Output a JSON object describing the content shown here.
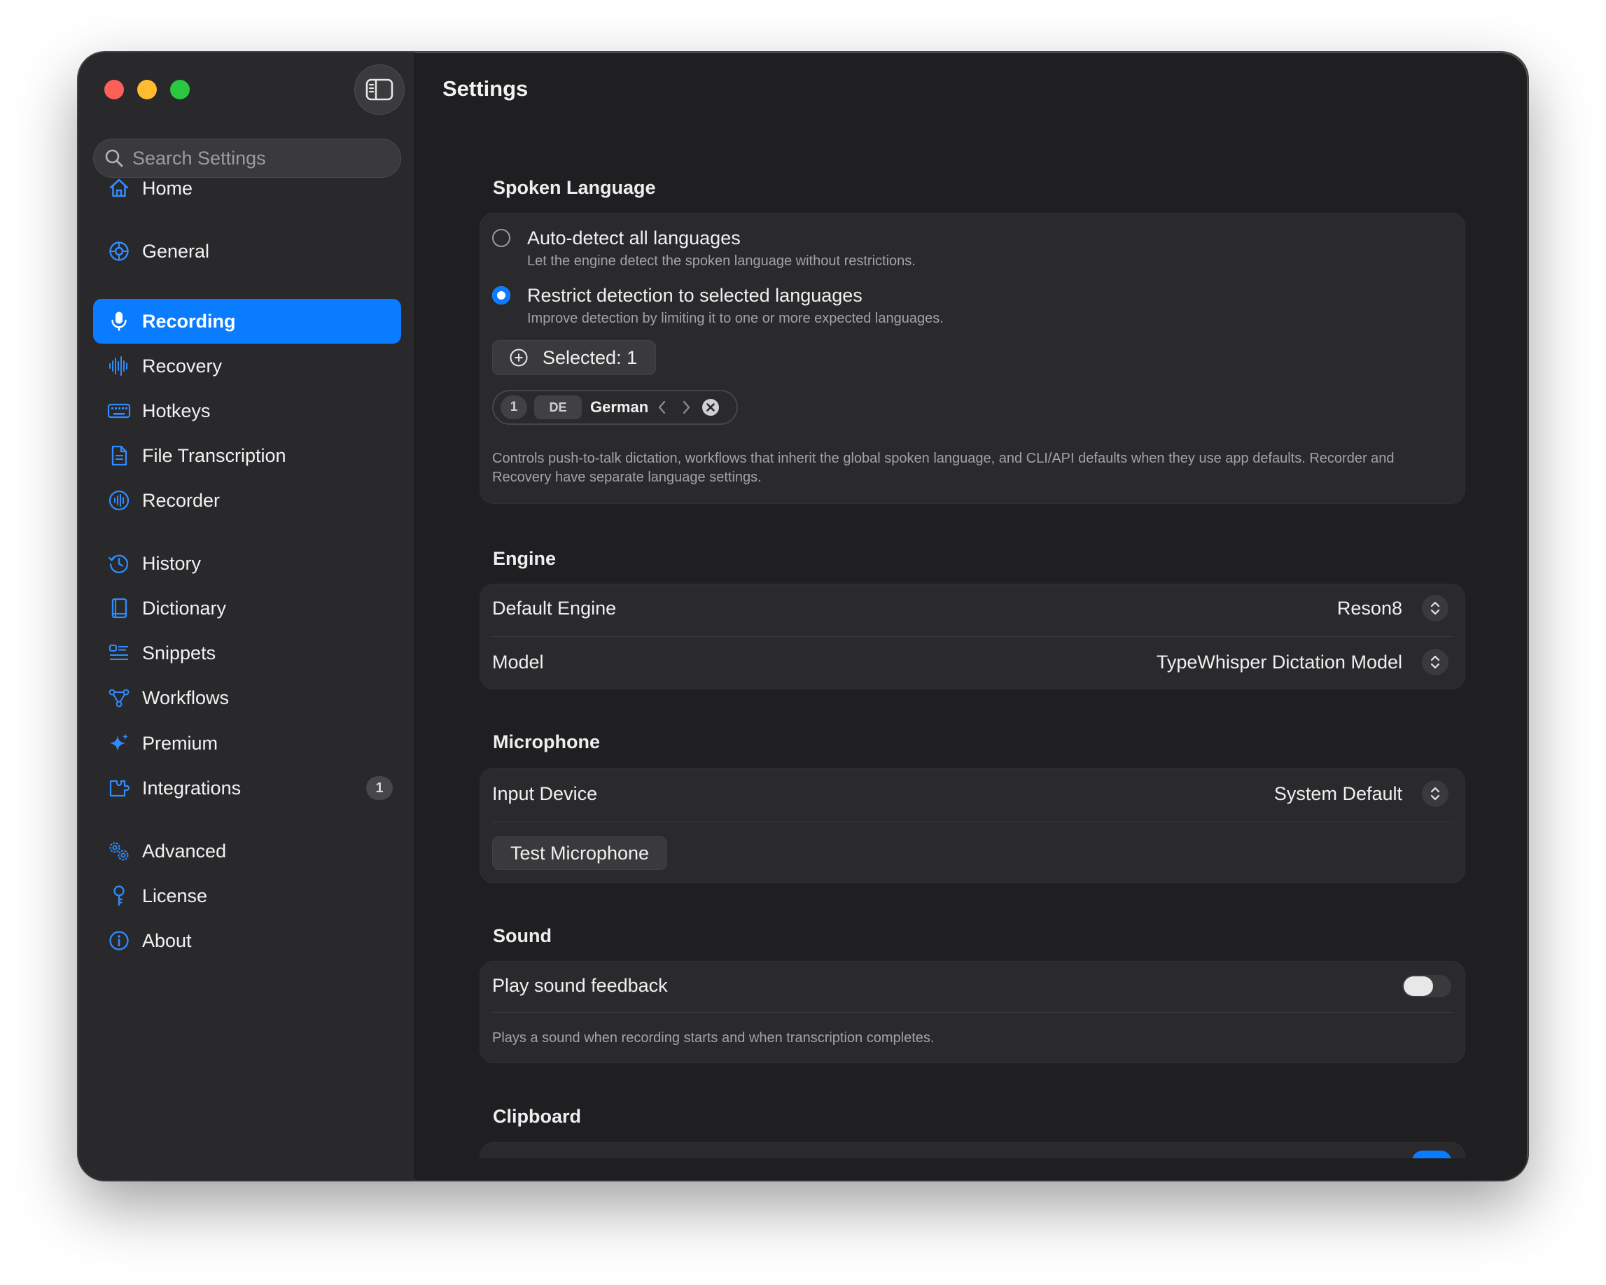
{
  "window": {
    "title": "Settings"
  },
  "sidebar": {
    "search_placeholder": "Search Settings",
    "items": [
      {
        "label": "Home",
        "icon": "house-icon"
      },
      {
        "label": "General",
        "icon": "gear-icon"
      },
      {
        "label": "Recording",
        "icon": "microphone-icon",
        "active": true
      },
      {
        "label": "Recovery",
        "icon": "waveform-icon"
      },
      {
        "label": "Hotkeys",
        "icon": "keyboard-icon"
      },
      {
        "label": "File Transcription",
        "icon": "document-icon"
      },
      {
        "label": "Recorder",
        "icon": "record-waveform-icon"
      },
      {
        "label": "History",
        "icon": "clock-history-icon"
      },
      {
        "label": "Dictionary",
        "icon": "book-icon"
      },
      {
        "label": "Snippets",
        "icon": "snippets-list-icon"
      },
      {
        "label": "Workflows",
        "icon": "workflow-nodes-icon"
      },
      {
        "label": "Premium",
        "icon": "sparkles-icon"
      },
      {
        "label": "Integrations",
        "icon": "puzzle-icon",
        "badge": "1"
      },
      {
        "label": "Advanced",
        "icon": "gears-icon"
      },
      {
        "label": "License",
        "icon": "key-icon"
      },
      {
        "label": "About",
        "icon": "info-circle-icon"
      }
    ]
  },
  "spoken_language": {
    "title": "Spoken Language",
    "auto_detect": {
      "title": "Auto-detect all languages",
      "subtitle": "Let the engine detect the spoken language without restrictions."
    },
    "restrict": {
      "title": "Restrict detection to selected languages",
      "subtitle": "Improve detection by limiting it to one or more expected languages."
    },
    "selected_label": "Selected: 1",
    "languages": [
      {
        "index": "1",
        "code": "DE",
        "name": "German"
      }
    ],
    "footnote": "Controls push-to-talk dictation, workflows that inherit the global spoken language, and CLI/API defaults when they use app defaults. Recorder and Recovery have separate language settings."
  },
  "engine": {
    "title": "Engine",
    "default_engine": {
      "label": "Default Engine",
      "value": "Reson8"
    },
    "model": {
      "label": "Model",
      "value": "TypeWhisper Dictation Model"
    }
  },
  "microphone": {
    "title": "Microphone",
    "input_device": {
      "label": "Input Device",
      "value": "System Default"
    },
    "test_button": "Test Microphone"
  },
  "sound": {
    "title": "Sound",
    "play_feedback": {
      "label": "Play sound feedback",
      "enabled": false
    },
    "footnote": "Plays a sound when recording starts and when transcription completes."
  },
  "clipboard": {
    "title": "Clipboard"
  },
  "colors": {
    "accent": "#0a7cff",
    "window_bg": "#1f1f21",
    "sidebar_bg": "#29292c",
    "card_bg": "#2a2a2d"
  }
}
